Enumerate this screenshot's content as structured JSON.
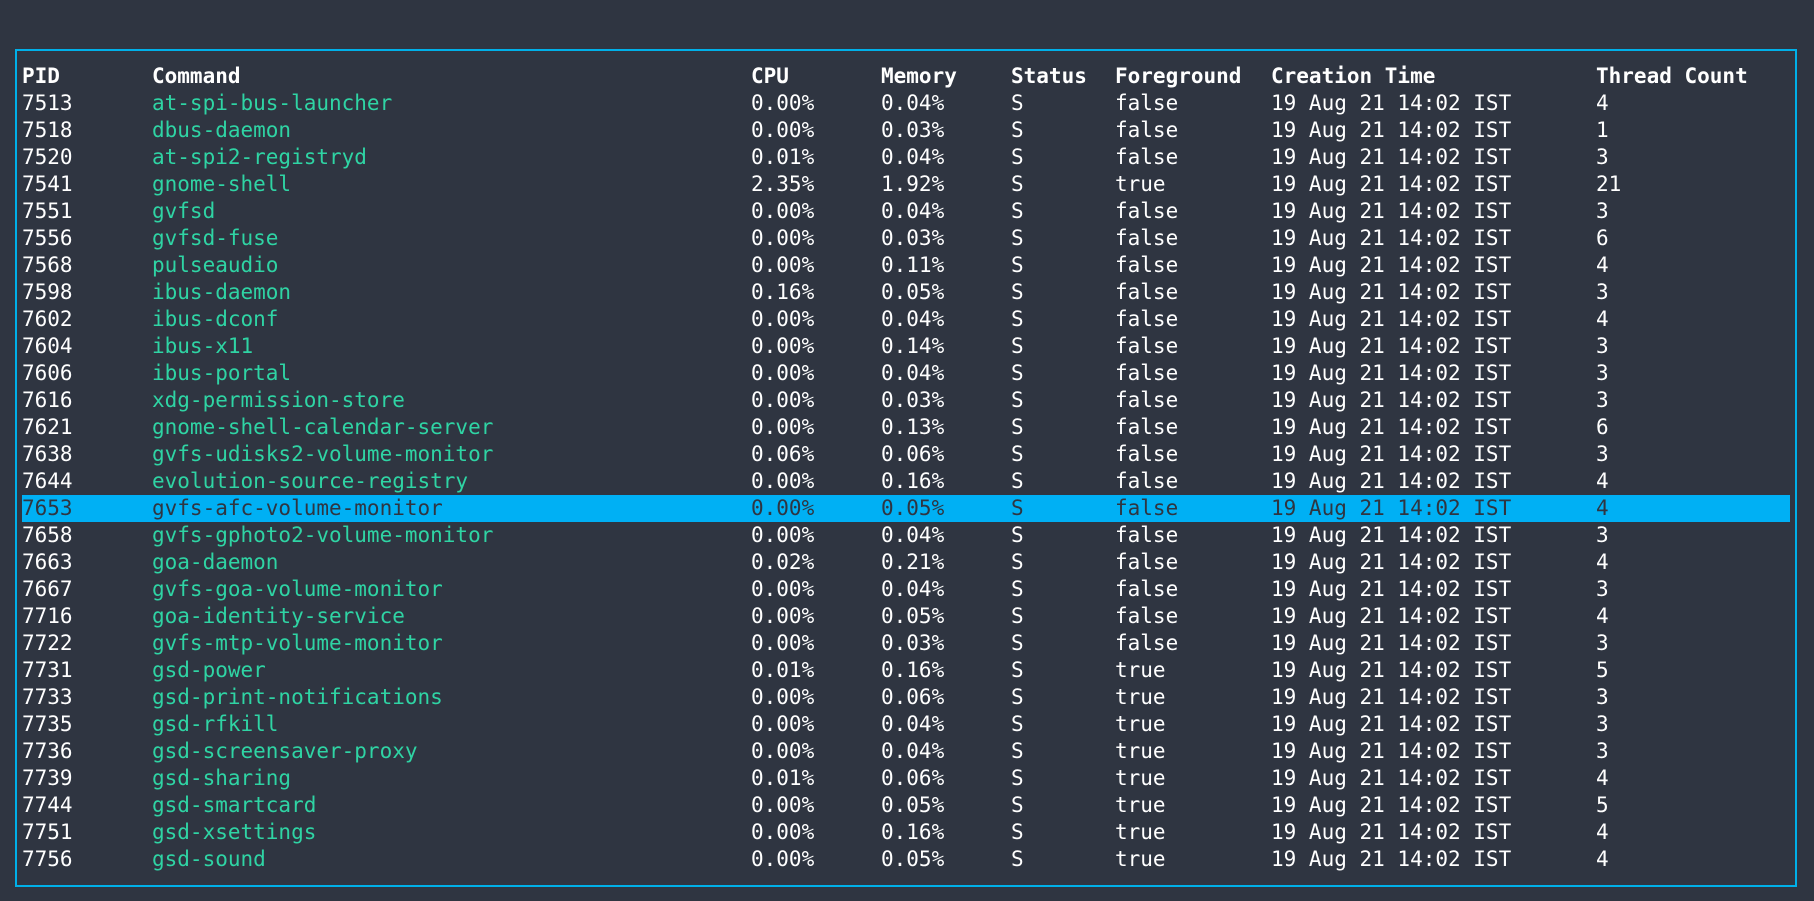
{
  "columns": [
    "PID",
    "Command",
    "CPU",
    "Memory",
    "Status",
    "Foreground",
    "Creation Time",
    "Thread Count"
  ],
  "selected_pid": "7653",
  "colors": {
    "background": "#2f3541",
    "border": "#00b0e8",
    "selection": "#00b0f4",
    "command": "#2fd4a4",
    "text": "#ffffff"
  },
  "rows": [
    {
      "pid": "7513",
      "command": "at-spi-bus-launcher",
      "cpu": "0.00%",
      "memory": "0.04%",
      "status": "S",
      "foreground": "false",
      "created": "19 Aug 21 14:02 IST",
      "threads": "4"
    },
    {
      "pid": "7518",
      "command": "dbus-daemon",
      "cpu": "0.00%",
      "memory": "0.03%",
      "status": "S",
      "foreground": "false",
      "created": "19 Aug 21 14:02 IST",
      "threads": "1"
    },
    {
      "pid": "7520",
      "command": "at-spi2-registryd",
      "cpu": "0.01%",
      "memory": "0.04%",
      "status": "S",
      "foreground": "false",
      "created": "19 Aug 21 14:02 IST",
      "threads": "3"
    },
    {
      "pid": "7541",
      "command": "gnome-shell",
      "cpu": "2.35%",
      "memory": "1.92%",
      "status": "S",
      "foreground": "true",
      "created": "19 Aug 21 14:02 IST",
      "threads": "21"
    },
    {
      "pid": "7551",
      "command": "gvfsd",
      "cpu": "0.00%",
      "memory": "0.04%",
      "status": "S",
      "foreground": "false",
      "created": "19 Aug 21 14:02 IST",
      "threads": "3"
    },
    {
      "pid": "7556",
      "command": "gvfsd-fuse",
      "cpu": "0.00%",
      "memory": "0.03%",
      "status": "S",
      "foreground": "false",
      "created": "19 Aug 21 14:02 IST",
      "threads": "6"
    },
    {
      "pid": "7568",
      "command": "pulseaudio",
      "cpu": "0.00%",
      "memory": "0.11%",
      "status": "S",
      "foreground": "false",
      "created": "19 Aug 21 14:02 IST",
      "threads": "4"
    },
    {
      "pid": "7598",
      "command": "ibus-daemon",
      "cpu": "0.16%",
      "memory": "0.05%",
      "status": "S",
      "foreground": "false",
      "created": "19 Aug 21 14:02 IST",
      "threads": "3"
    },
    {
      "pid": "7602",
      "command": "ibus-dconf",
      "cpu": "0.00%",
      "memory": "0.04%",
      "status": "S",
      "foreground": "false",
      "created": "19 Aug 21 14:02 IST",
      "threads": "4"
    },
    {
      "pid": "7604",
      "command": "ibus-x11",
      "cpu": "0.00%",
      "memory": "0.14%",
      "status": "S",
      "foreground": "false",
      "created": "19 Aug 21 14:02 IST",
      "threads": "3"
    },
    {
      "pid": "7606",
      "command": "ibus-portal",
      "cpu": "0.00%",
      "memory": "0.04%",
      "status": "S",
      "foreground": "false",
      "created": "19 Aug 21 14:02 IST",
      "threads": "3"
    },
    {
      "pid": "7616",
      "command": "xdg-permission-store",
      "cpu": "0.00%",
      "memory": "0.03%",
      "status": "S",
      "foreground": "false",
      "created": "19 Aug 21 14:02 IST",
      "threads": "3"
    },
    {
      "pid": "7621",
      "command": "gnome-shell-calendar-server",
      "cpu": "0.00%",
      "memory": "0.13%",
      "status": "S",
      "foreground": "false",
      "created": "19 Aug 21 14:02 IST",
      "threads": "6"
    },
    {
      "pid": "7638",
      "command": "gvfs-udisks2-volume-monitor",
      "cpu": "0.06%",
      "memory": "0.06%",
      "status": "S",
      "foreground": "false",
      "created": "19 Aug 21 14:02 IST",
      "threads": "3"
    },
    {
      "pid": "7644",
      "command": "evolution-source-registry",
      "cpu": "0.00%",
      "memory": "0.16%",
      "status": "S",
      "foreground": "false",
      "created": "19 Aug 21 14:02 IST",
      "threads": "4"
    },
    {
      "pid": "7653",
      "command": "gvfs-afc-volume-monitor",
      "cpu": "0.00%",
      "memory": "0.05%",
      "status": "S",
      "foreground": "false",
      "created": "19 Aug 21 14:02 IST",
      "threads": "4"
    },
    {
      "pid": "7658",
      "command": "gvfs-gphoto2-volume-monitor",
      "cpu": "0.00%",
      "memory": "0.04%",
      "status": "S",
      "foreground": "false",
      "created": "19 Aug 21 14:02 IST",
      "threads": "3"
    },
    {
      "pid": "7663",
      "command": "goa-daemon",
      "cpu": "0.02%",
      "memory": "0.21%",
      "status": "S",
      "foreground": "false",
      "created": "19 Aug 21 14:02 IST",
      "threads": "4"
    },
    {
      "pid": "7667",
      "command": "gvfs-goa-volume-monitor",
      "cpu": "0.00%",
      "memory": "0.04%",
      "status": "S",
      "foreground": "false",
      "created": "19 Aug 21 14:02 IST",
      "threads": "3"
    },
    {
      "pid": "7716",
      "command": "goa-identity-service",
      "cpu": "0.00%",
      "memory": "0.05%",
      "status": "S",
      "foreground": "false",
      "created": "19 Aug 21 14:02 IST",
      "threads": "4"
    },
    {
      "pid": "7722",
      "command": "gvfs-mtp-volume-monitor",
      "cpu": "0.00%",
      "memory": "0.03%",
      "status": "S",
      "foreground": "false",
      "created": "19 Aug 21 14:02 IST",
      "threads": "3"
    },
    {
      "pid": "7731",
      "command": "gsd-power",
      "cpu": "0.01%",
      "memory": "0.16%",
      "status": "S",
      "foreground": "true",
      "created": "19 Aug 21 14:02 IST",
      "threads": "5"
    },
    {
      "pid": "7733",
      "command": "gsd-print-notifications",
      "cpu": "0.00%",
      "memory": "0.06%",
      "status": "S",
      "foreground": "true",
      "created": "19 Aug 21 14:02 IST",
      "threads": "3"
    },
    {
      "pid": "7735",
      "command": "gsd-rfkill",
      "cpu": "0.00%",
      "memory": "0.04%",
      "status": "S",
      "foreground": "true",
      "created": "19 Aug 21 14:02 IST",
      "threads": "3"
    },
    {
      "pid": "7736",
      "command": "gsd-screensaver-proxy",
      "cpu": "0.00%",
      "memory": "0.04%",
      "status": "S",
      "foreground": "true",
      "created": "19 Aug 21 14:02 IST",
      "threads": "3"
    },
    {
      "pid": "7739",
      "command": "gsd-sharing",
      "cpu": "0.01%",
      "memory": "0.06%",
      "status": "S",
      "foreground": "true",
      "created": "19 Aug 21 14:02 IST",
      "threads": "4"
    },
    {
      "pid": "7744",
      "command": "gsd-smartcard",
      "cpu": "0.00%",
      "memory": "0.05%",
      "status": "S",
      "foreground": "true",
      "created": "19 Aug 21 14:02 IST",
      "threads": "5"
    },
    {
      "pid": "7751",
      "command": "gsd-xsettings",
      "cpu": "0.00%",
      "memory": "0.16%",
      "status": "S",
      "foreground": "true",
      "created": "19 Aug 21 14:02 IST",
      "threads": "4"
    },
    {
      "pid": "7756",
      "command": "gsd-sound",
      "cpu": "0.00%",
      "memory": "0.05%",
      "status": "S",
      "foreground": "true",
      "created": "19 Aug 21 14:02 IST",
      "threads": "4"
    }
  ]
}
